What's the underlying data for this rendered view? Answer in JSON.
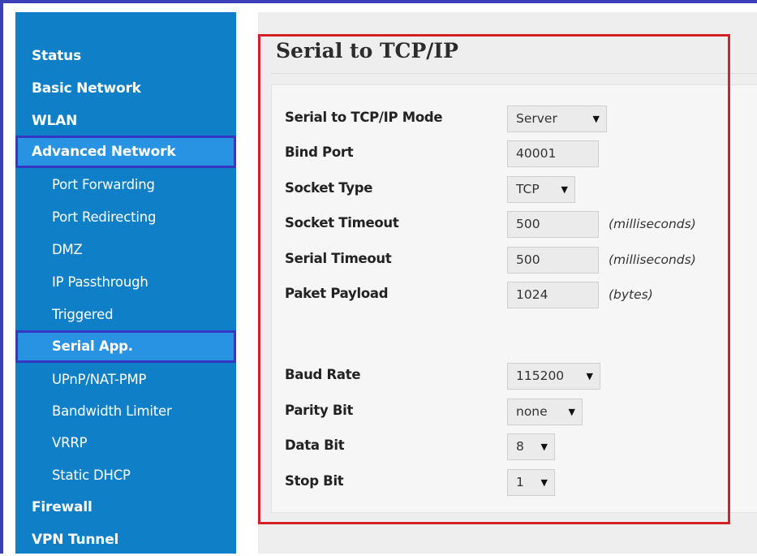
{
  "sidebar": {
    "items": [
      {
        "label": "Status"
      },
      {
        "label": "Basic Network"
      },
      {
        "label": "WLAN"
      },
      {
        "label": "Advanced Network"
      },
      {
        "label": "Port Forwarding"
      },
      {
        "label": "Port Redirecting"
      },
      {
        "label": "DMZ"
      },
      {
        "label": "IP Passthrough"
      },
      {
        "label": "Triggered"
      },
      {
        "label": "Serial App."
      },
      {
        "label": "UPnP/NAT-PMP"
      },
      {
        "label": "Bandwidth Limiter"
      },
      {
        "label": "VRRP"
      },
      {
        "label": "Static DHCP"
      },
      {
        "label": "Firewall"
      },
      {
        "label": "VPN Tunnel"
      }
    ]
  },
  "main": {
    "title": "Serial to TCP/IP",
    "fields": {
      "mode": {
        "label": "Serial to TCP/IP Mode",
        "value": "Server"
      },
      "bind_port": {
        "label": "Bind Port",
        "value": "40001"
      },
      "socket_type": {
        "label": "Socket Type",
        "value": "TCP"
      },
      "socket_timeout": {
        "label": "Socket Timeout",
        "value": "500",
        "unit": "(milliseconds)"
      },
      "serial_timeout": {
        "label": "Serial Timeout",
        "value": "500",
        "unit": "(milliseconds)"
      },
      "payload": {
        "label": "Paket Payload",
        "value": "1024",
        "unit": "(bytes)"
      },
      "baud_rate": {
        "label": "Baud Rate",
        "value": "115200"
      },
      "parity_bit": {
        "label": "Parity Bit",
        "value": "none"
      },
      "data_bit": {
        "label": "Data Bit",
        "value": "8"
      },
      "stop_bit": {
        "label": "Stop Bit",
        "value": "1"
      }
    },
    "caret": "▼"
  },
  "colors": {
    "sidebar": "#0f7fc8",
    "sidebar_active": "#2893e3",
    "highlight_box": "#3636c4",
    "annotation_red": "#d42027"
  }
}
